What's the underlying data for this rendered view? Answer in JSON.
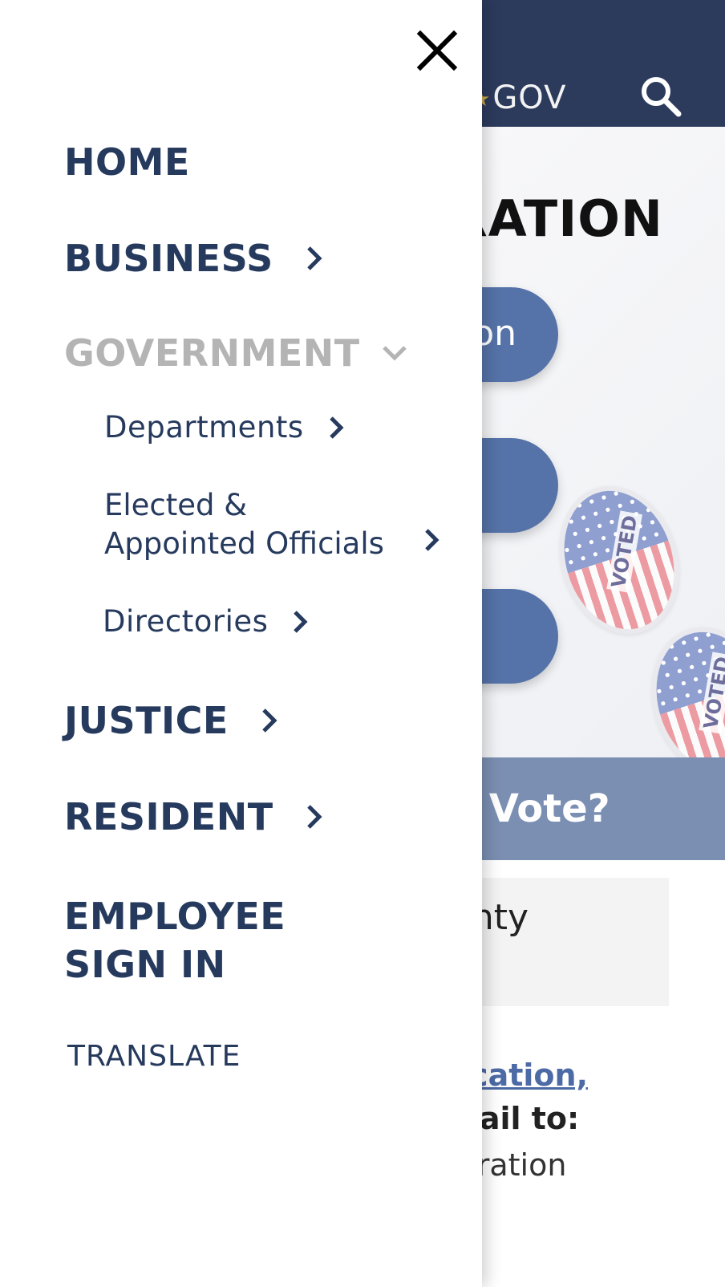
{
  "background_page": {
    "header_logo": "GOV",
    "title_partial": "RATION",
    "buttons": [
      "on",
      "",
      ""
    ],
    "sticker_word": "VOTED",
    "banner_partial": "o Vote?",
    "box_partial": "unty",
    "link_partial": "lication,",
    "mail_partial": "Mail to:",
    "text_partial": "stration",
    "colors": {
      "header": "#2c3a5c",
      "button": "#5573a8",
      "banner": "#7b8fb2",
      "link": "#4c6aa6"
    }
  },
  "drawer": {
    "close_icon": "close-icon",
    "items": [
      {
        "label": "HOME"
      },
      {
        "label": "BUSINESS",
        "icon": "chevron-right-icon"
      },
      {
        "label": "GOVERNMENT",
        "icon": "chevron-down-icon",
        "expanded": true
      },
      {
        "label": "JUSTICE",
        "icon": "chevron-right-icon"
      },
      {
        "label": "RESIDENT",
        "icon": "chevron-right-icon"
      },
      {
        "label_line1": "EMPLOYEE",
        "label_line2": "SIGN IN"
      },
      {
        "label": "TRANSLATE"
      }
    ],
    "sub_items": [
      {
        "label": "Departments"
      },
      {
        "label_line1": "Elected &",
        "label_line2": "Appointed Officials"
      },
      {
        "label": "Directories"
      }
    ],
    "colors": {
      "text": "#263a5e",
      "muted": "#b4b4b4"
    }
  }
}
